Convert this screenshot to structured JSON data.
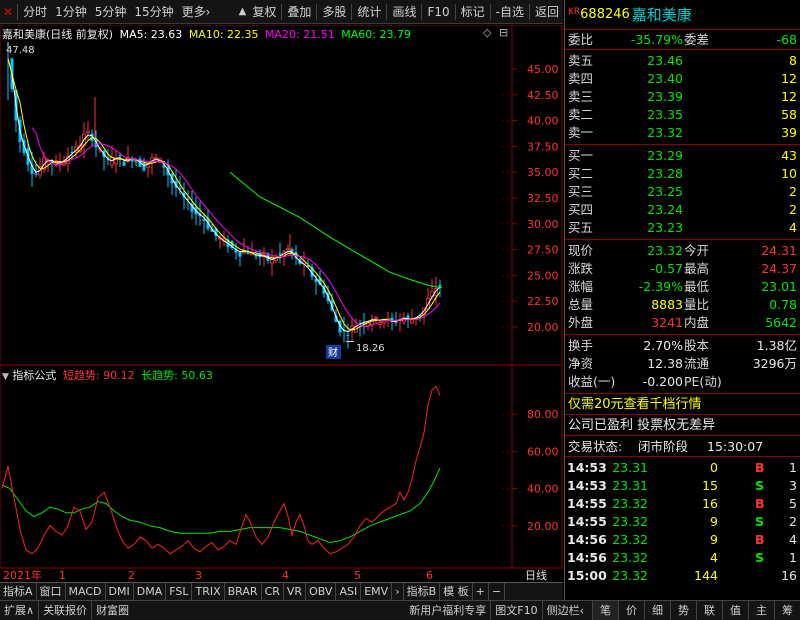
{
  "toolbar": {
    "items": [
      "分时",
      "1分钟",
      "5分钟",
      "15分钟",
      "更多›",
      "复权",
      "叠加",
      "多股",
      "统计",
      "画线",
      "F10",
      "标记",
      "-自选",
      "返回"
    ]
  },
  "main_chart": {
    "name": "嘉和美康(日线 前复权)",
    "ma": [
      {
        "label": "MA5: 23.63",
        "color": "#ffffff"
      },
      {
        "label": "MA10: 22.35",
        "color": "#ffff00"
      },
      {
        "label": "MA20: 21.51",
        "color": "#ff00ff"
      },
      {
        "label": "MA60: 23.79",
        "color": "#00ff00"
      }
    ],
    "high_label": "47.48",
    "low_label": "18.26",
    "cai_label": "财",
    "y_ticks": [
      "45.00",
      "42.50",
      "40.00",
      "37.50",
      "35.00",
      "32.50",
      "30.00",
      "27.50",
      "25.00",
      "22.50",
      "20.00"
    ]
  },
  "ind_chart": {
    "title": "指标公式",
    "short_label": "短趋势: 90.12",
    "long_label": "长趋势: 50.63",
    "y_ticks": [
      "80.00",
      "60.00",
      "40.00",
      "20.00"
    ]
  },
  "x_axis": {
    "labels": [
      "2021年",
      "1",
      "2",
      "3",
      "4",
      "5",
      "6"
    ],
    "right_label": "日线"
  },
  "tabs": [
    "指标A",
    "窗口",
    "MACD",
    "DMI",
    "DMA",
    "FSL",
    "TRIX",
    "BRAR",
    "CR",
    "VR",
    "OBV",
    "ASI",
    "EMV",
    "›",
    "指标B",
    "模 板",
    "+",
    "−"
  ],
  "statusbar": {
    "left": [
      "扩展∧",
      "关联报价",
      "财富圈"
    ],
    "mid": [
      "新用户福利专享",
      "图文F10",
      "侧边栏‹"
    ],
    "right": [
      "笔",
      "价",
      "细",
      "势",
      "联",
      "值",
      "主",
      "筹"
    ]
  },
  "quote": {
    "kr": "KR",
    "code": "688246",
    "name": "嘉和美康",
    "weibi_label": "委比",
    "weibi": "-35.79%",
    "weicha_label": "委差",
    "weicha": "-68",
    "asks": [
      {
        "label": "卖五",
        "price": "23.46",
        "vol": "8"
      },
      {
        "label": "卖四",
        "price": "23.40",
        "vol": "12"
      },
      {
        "label": "卖三",
        "price": "23.39",
        "vol": "12"
      },
      {
        "label": "卖二",
        "price": "23.35",
        "vol": "58"
      },
      {
        "label": "卖一",
        "price": "23.32",
        "vol": "39"
      }
    ],
    "bids": [
      {
        "label": "买一",
        "price": "23.29",
        "vol": "43"
      },
      {
        "label": "买二",
        "price": "23.28",
        "vol": "10"
      },
      {
        "label": "买三",
        "price": "23.25",
        "vol": "2"
      },
      {
        "label": "买四",
        "price": "23.24",
        "vol": "2"
      },
      {
        "label": "买五",
        "price": "23.23",
        "vol": "4"
      }
    ],
    "stats": [
      {
        "l1": "现价",
        "v1": "23.32",
        "c1": "green",
        "l2": "今开",
        "v2": "24.31",
        "c2": "red"
      },
      {
        "l1": "涨跌",
        "v1": "-0.57",
        "c1": "green",
        "l2": "最高",
        "v2": "24.37",
        "c2": "red"
      },
      {
        "l1": "涨幅",
        "v1": "-2.39%",
        "c1": "green",
        "l2": "最低",
        "v2": "23.01",
        "c2": "green"
      },
      {
        "l1": "总量",
        "v1": "8883",
        "c1": "yellow",
        "l2": "量比",
        "v2": "0.78",
        "c2": "green"
      },
      {
        "l1": "外盘",
        "v1": "3241",
        "c1": "red",
        "l2": "内盘",
        "v2": "5642",
        "c2": "green"
      }
    ],
    "stats2": [
      {
        "l1": "换手",
        "v1": "2.70%",
        "l2": "股本",
        "v2": "1.38亿"
      },
      {
        "l1": "净资",
        "v1": "12.38",
        "l2": "流通",
        "v2": "3296万"
      },
      {
        "l1": "收益(一)",
        "v1": "-0.200",
        "l2": "PE(动)",
        "v2": ""
      }
    ],
    "promo": "仅需20元查看千档行情",
    "note": "公司已盈利 投票权无差异",
    "trade_state_label": "交易状态:",
    "trade_state": "闭市阶段",
    "trade_time": "15:30:07",
    "ticks": [
      {
        "t": "14:53",
        "p": "23.31",
        "v": "0",
        "f": "B",
        "fc": "red",
        "n": "1"
      },
      {
        "t": "14:53",
        "p": "23.31",
        "v": "15",
        "f": "S",
        "fc": "green",
        "n": "3"
      },
      {
        "t": "14:55",
        "p": "23.32",
        "v": "16",
        "f": "B",
        "fc": "red",
        "n": "5"
      },
      {
        "t": "14:55",
        "p": "23.32",
        "v": "9",
        "f": "S",
        "fc": "green",
        "n": "2"
      },
      {
        "t": "14:56",
        "p": "23.32",
        "v": "9",
        "f": "B",
        "fc": "red",
        "n": "4"
      },
      {
        "t": "14:56",
        "p": "23.32",
        "v": "4",
        "f": "S",
        "fc": "green",
        "n": "1"
      },
      {
        "t": "15:00",
        "p": "23.32",
        "v": "144",
        "f": "",
        "fc": "white",
        "n": "16"
      }
    ]
  },
  "colors": {
    "up": "#ff3232",
    "down": "#00e600",
    "candle_down": "#00c8ff",
    "grid": "#8a0000"
  }
}
